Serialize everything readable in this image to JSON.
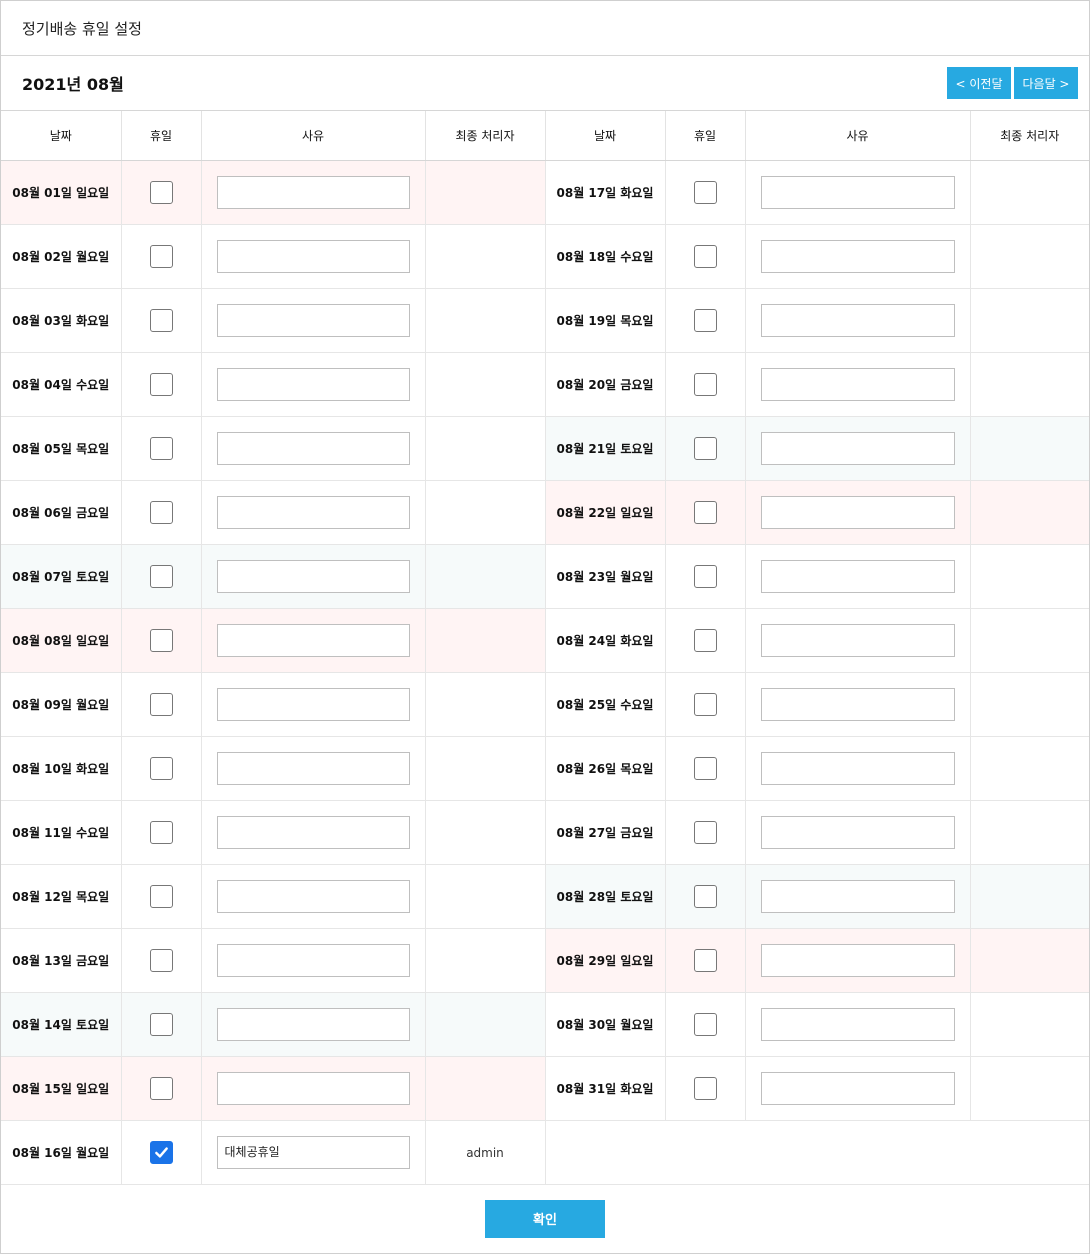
{
  "title": "정기배송 휴일 설정",
  "month_label": "2021년 08월",
  "nav": {
    "prev_label": "< 이전달",
    "next_label": "다음달 >"
  },
  "columns": [
    "날짜",
    "휴일",
    "사유",
    "최종 처리자",
    "날짜",
    "휴일",
    "사유",
    "최종 처리자"
  ],
  "colors": {
    "accent": "#27a9e1",
    "checkbox_checked": "#1a73e8",
    "sunday_bg": "#fff4f4",
    "saturday_bg": "#f6fafa"
  },
  "days": [
    {
      "date": "08월 01일 일요일",
      "holiday": false,
      "reason": "",
      "processor": "",
      "type": "sun"
    },
    {
      "date": "08월 02일 월요일",
      "holiday": false,
      "reason": "",
      "processor": "",
      "type": ""
    },
    {
      "date": "08월 03일 화요일",
      "holiday": false,
      "reason": "",
      "processor": "",
      "type": ""
    },
    {
      "date": "08월 04일 수요일",
      "holiday": false,
      "reason": "",
      "processor": "",
      "type": ""
    },
    {
      "date": "08월 05일 목요일",
      "holiday": false,
      "reason": "",
      "processor": "",
      "type": ""
    },
    {
      "date": "08월 06일 금요일",
      "holiday": false,
      "reason": "",
      "processor": "",
      "type": ""
    },
    {
      "date": "08월 07일 토요일",
      "holiday": false,
      "reason": "",
      "processor": "",
      "type": "sat"
    },
    {
      "date": "08월 08일 일요일",
      "holiday": false,
      "reason": "",
      "processor": "",
      "type": "sun"
    },
    {
      "date": "08월 09일 월요일",
      "holiday": false,
      "reason": "",
      "processor": "",
      "type": ""
    },
    {
      "date": "08월 10일 화요일",
      "holiday": false,
      "reason": "",
      "processor": "",
      "type": ""
    },
    {
      "date": "08월 11일 수요일",
      "holiday": false,
      "reason": "",
      "processor": "",
      "type": ""
    },
    {
      "date": "08월 12일 목요일",
      "holiday": false,
      "reason": "",
      "processor": "",
      "type": ""
    },
    {
      "date": "08월 13일 금요일",
      "holiday": false,
      "reason": "",
      "processor": "",
      "type": ""
    },
    {
      "date": "08월 14일 토요일",
      "holiday": false,
      "reason": "",
      "processor": "",
      "type": "sat"
    },
    {
      "date": "08월 15일 일요일",
      "holiday": false,
      "reason": "",
      "processor": "",
      "type": "sun"
    },
    {
      "date": "08월 16일 월요일",
      "holiday": true,
      "reason": "대체공휴일",
      "processor": "admin",
      "type": ""
    },
    {
      "date": "08월 17일 화요일",
      "holiday": false,
      "reason": "",
      "processor": "",
      "type": ""
    },
    {
      "date": "08월 18일 수요일",
      "holiday": false,
      "reason": "",
      "processor": "",
      "type": ""
    },
    {
      "date": "08월 19일 목요일",
      "holiday": false,
      "reason": "",
      "processor": "",
      "type": ""
    },
    {
      "date": "08월 20일 금요일",
      "holiday": false,
      "reason": "",
      "processor": "",
      "type": ""
    },
    {
      "date": "08월 21일 토요일",
      "holiday": false,
      "reason": "",
      "processor": "",
      "type": "sat"
    },
    {
      "date": "08월 22일 일요일",
      "holiday": false,
      "reason": "",
      "processor": "",
      "type": "sun"
    },
    {
      "date": "08월 23일 월요일",
      "holiday": false,
      "reason": "",
      "processor": "",
      "type": ""
    },
    {
      "date": "08월 24일 화요일",
      "holiday": false,
      "reason": "",
      "processor": "",
      "type": ""
    },
    {
      "date": "08월 25일 수요일",
      "holiday": false,
      "reason": "",
      "processor": "",
      "type": ""
    },
    {
      "date": "08월 26일 목요일",
      "holiday": false,
      "reason": "",
      "processor": "",
      "type": ""
    },
    {
      "date": "08월 27일 금요일",
      "holiday": false,
      "reason": "",
      "processor": "",
      "type": ""
    },
    {
      "date": "08월 28일 토요일",
      "holiday": false,
      "reason": "",
      "processor": "",
      "type": "sat"
    },
    {
      "date": "08월 29일 일요일",
      "holiday": false,
      "reason": "",
      "processor": "",
      "type": "sun"
    },
    {
      "date": "08월 30일 월요일",
      "holiday": false,
      "reason": "",
      "processor": "",
      "type": ""
    },
    {
      "date": "08월 31일 화요일",
      "holiday": false,
      "reason": "",
      "processor": "",
      "type": ""
    }
  ],
  "confirm_label": "확인"
}
